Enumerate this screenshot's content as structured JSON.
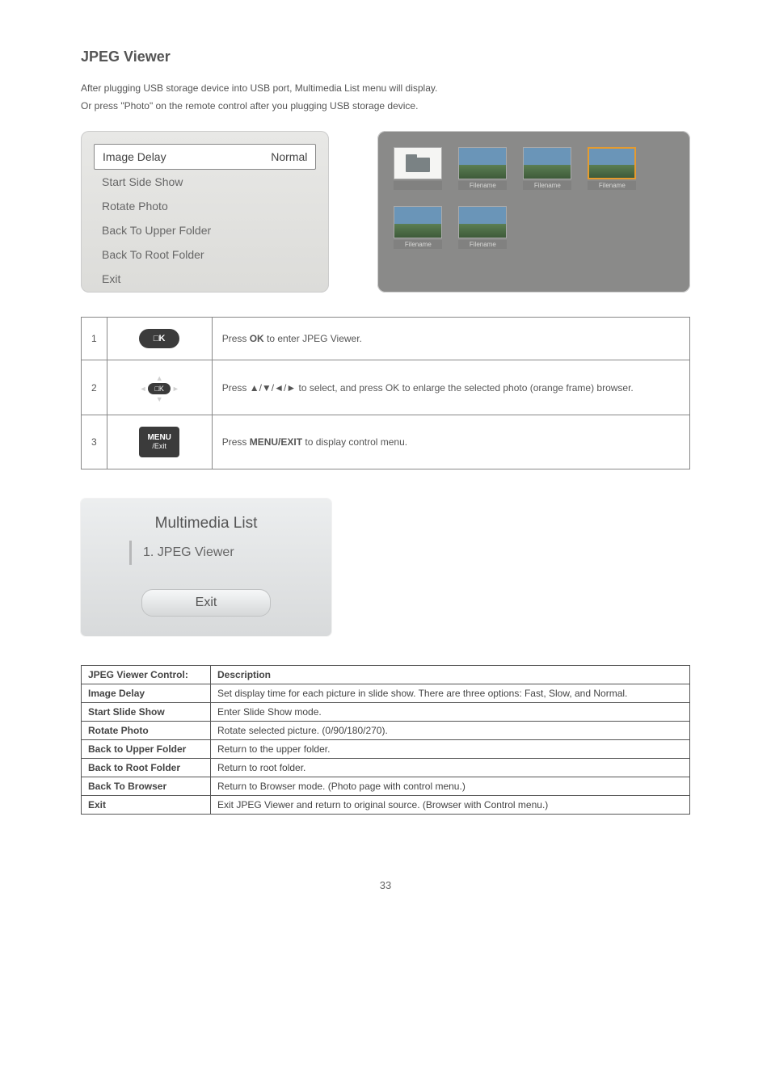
{
  "title": "JPEG Viewer",
  "intro_line1": "After plugging USB storage device into USB port, Multimedia List menu will display.",
  "intro_line2": "Or press \"Photo\" on the remote control after you plugging USB storage device.",
  "osd": {
    "items": [
      {
        "label": "Image Delay",
        "value": "Normal",
        "selected": true
      },
      {
        "label": "Start Side Show",
        "value": "",
        "selected": false
      },
      {
        "label": "Rotate Photo",
        "value": "",
        "selected": false
      },
      {
        "label": "Back To Upper Folder",
        "value": "",
        "selected": false
      },
      {
        "label": "Back To Root Folder",
        "value": "",
        "selected": false
      },
      {
        "label": "Exit",
        "value": "",
        "selected": false
      }
    ]
  },
  "thumbs": {
    "folder_caption": "",
    "items": [
      {
        "caption": "Filename",
        "highlight": false
      },
      {
        "caption": "Filename",
        "highlight": false
      },
      {
        "caption": "Filename",
        "highlight": true
      },
      {
        "caption": "Filename",
        "highlight": false
      },
      {
        "caption": "Filename",
        "highlight": false
      }
    ]
  },
  "button_rows": [
    {
      "num": "1",
      "btn": "OK",
      "btn_sub": "",
      "desc_prefix": "Press ",
      "desc_bold": "OK",
      "desc_suffix": " to enter JPEG Viewer."
    },
    {
      "num": "2",
      "btn": "DPAD",
      "btn_sub": "",
      "desc_prefix": "Press ▲/▼/◄/► to select, and press OK to enlarge the selected photo (orange frame) browser.",
      "desc_bold": "",
      "desc_suffix": ""
    },
    {
      "num": "3",
      "btn": "MENU",
      "btn_sub": "/Exit",
      "desc_prefix": "Press ",
      "desc_bold": "MENU/EXIT",
      "desc_suffix": " to display control menu."
    }
  ],
  "multimedia": {
    "title": "Multimedia List",
    "item1": "1. JPEG Viewer",
    "exit": "Exit"
  },
  "desc_table": {
    "header_left": "JPEG Viewer Control:",
    "header_right": "Description",
    "rows": [
      {
        "label": "Image Delay",
        "desc": "Set display time for each picture in slide show. There are three options: Fast, Slow, and Normal."
      },
      {
        "label": "Start Slide Show",
        "desc": "Enter Slide Show mode."
      },
      {
        "label": "Rotate Photo",
        "desc": "Rotate selected picture. (0/90/180/270)."
      },
      {
        "label": "Back to Upper Folder",
        "desc": "Return to the upper folder."
      },
      {
        "label": "Back to Root Folder",
        "desc": "Return to root folder."
      },
      {
        "label": "Back To Browser",
        "desc": "Return to Browser mode. (Photo page with control menu.)"
      },
      {
        "label": "Exit",
        "desc": "Exit JPEG Viewer and return to original source. (Browser with Control menu.)"
      }
    ]
  },
  "page_number": "33"
}
